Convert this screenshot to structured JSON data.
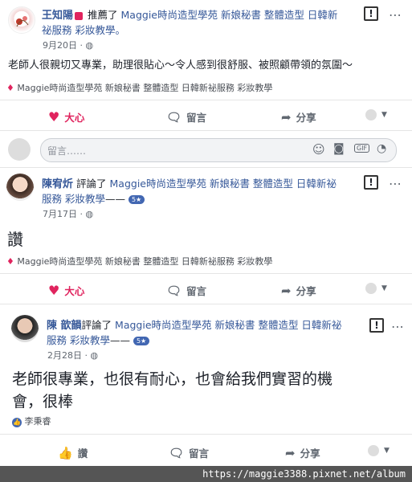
{
  "post1": {
    "author": "王知陽",
    "action": "推薦了",
    "page": "Maggie時尚造型學苑 新娘秘書 整體造型 日韓新",
    "page_cont": "祕服務 彩妝教學。",
    "date": "9月20日",
    "body": "老師人很親切又專業，助理很貼心～令人感到很舒服、被照顧帶領的氛圍～",
    "tag": "Maggie時尚造型學苑 新娘秘書 整體造型 日韓新祕服務 彩妝教學",
    "react_label": "大心",
    "comment_label": "留言",
    "share_label": "分享"
  },
  "comment_input": {
    "placeholder": "留言……"
  },
  "post2": {
    "author": "陳宥炘",
    "action": "評論了",
    "page": "Maggie時尚造型學苑 新娘秘書 整體造型 日韓新祕",
    "page_cont": "服務 彩妝教學",
    "badge": "5★",
    "date": "7月17日",
    "body": "讚",
    "tag": "Maggie時尚造型學苑 新娘秘書 整體造型 日韓新祕服務 彩妝教學",
    "react_label": "大心",
    "comment_label": "留言",
    "share_label": "分享"
  },
  "post3": {
    "author": "陳 歆韻",
    "action": "評論了",
    "page": "Maggie時尚造型學苑 新娘秘書 整體造型 日韓新祕",
    "page_cont": "服務 彩妝教學",
    "badge": "5★",
    "date": "2月28日",
    "body_line1": "老師很專業，也很有耐心，也會給我們實習的機",
    "body_line2": "會，很棒",
    "liker": "李秉睿",
    "like_label": "讚",
    "comment_label": "留言",
    "share_label": "分享"
  },
  "watermark_url": "https://maggie3388.pixnet.net/album",
  "colors": {
    "link": "#365899",
    "heart": "#e0245e",
    "like_blue": "#4267b2"
  }
}
